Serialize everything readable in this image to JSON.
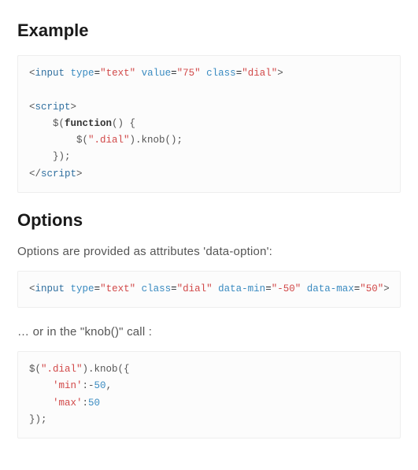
{
  "example": {
    "heading": "Example",
    "code_html": "<span class=\"c-plain\">&lt;</span><span class=\"c-tag\">input</span> <span class=\"c-attr\">type</span>=<span class=\"c-str\">\"text\"</span> <span class=\"c-attr\">value</span>=<span class=\"c-str\">\"75\"</span> <span class=\"c-attr\">class</span>=<span class=\"c-str\">\"dial\"</span><span class=\"c-plain\">&gt;</span>\n\n<span class=\"c-plain\">&lt;</span><span class=\"c-tag\">script</span><span class=\"c-plain\">&gt;</span>\n    <span class=\"c-plain\">$(</span><span class=\"c-fn\">function</span><span class=\"c-plain\">() {</span>\n        <span class=\"c-plain\">$(</span><span class=\"c-str\">\".dial\"</span><span class=\"c-plain\">).knob();</span>\n    <span class=\"c-plain\">});</span>\n<span class=\"c-plain\">&lt;/</span><span class=\"c-tag\">script</span><span class=\"c-plain\">&gt;</span>"
  },
  "options": {
    "heading": "Options",
    "intro": "Options are provided as attributes 'data-option':",
    "code1_html": "<span class=\"c-plain\">&lt;</span><span class=\"c-tag\">input</span> <span class=\"c-attr\">type</span>=<span class=\"c-str\">\"text\"</span> <span class=\"c-attr\">class</span>=<span class=\"c-str\">\"dial\"</span> <span class=\"c-attr\">data-min</span>=<span class=\"c-str\">\"-50\"</span> <span class=\"c-attr\">data-max</span>=<span class=\"c-str\">\"50\"</span><span class=\"c-plain\">&gt;</span>",
    "or_text": "… or in the \"knob()\" call :",
    "code2_html": "<span class=\"c-plain\">$(</span><span class=\"c-str\">\".dial\"</span><span class=\"c-plain\">).knob({</span>\n    <span class=\"c-str\">'min'</span><span class=\"c-plain\">:-</span><span class=\"c-num\">50</span><span class=\"c-plain\">,</span>\n    <span class=\"c-str\">'max'</span><span class=\"c-plain\">:</span><span class=\"c-num\">50</span>\n<span class=\"c-plain\">});</span>"
  }
}
